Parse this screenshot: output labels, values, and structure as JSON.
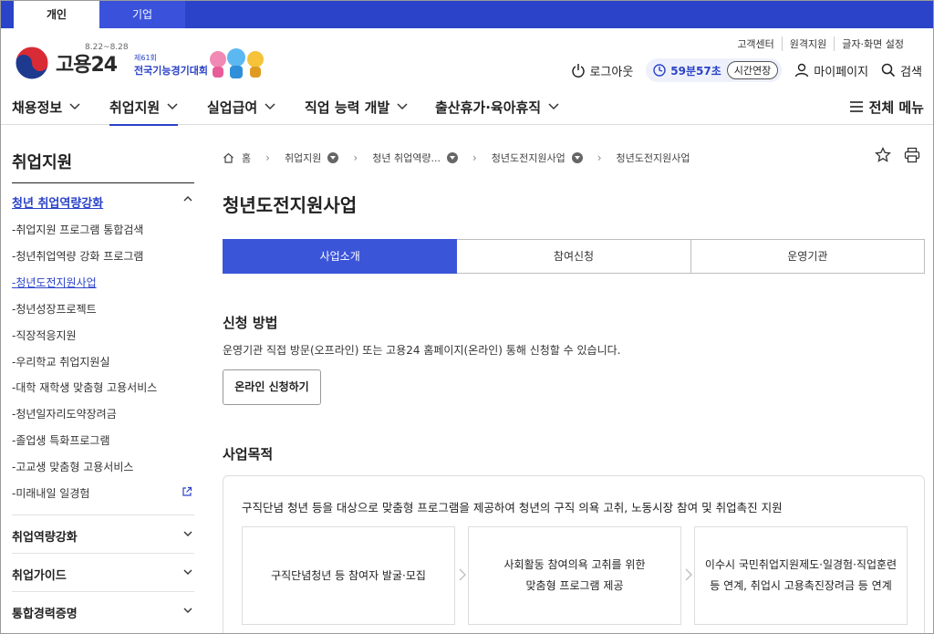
{
  "top_tabs": [
    "개인",
    "기업"
  ],
  "logo": {
    "text": "고용24"
  },
  "event": {
    "dates": "8.22~8.28",
    "sub": "제61회",
    "name": "전국기능경기대회"
  },
  "utility_links": [
    "고객센터",
    "원격지원",
    "글자·화면 설정"
  ],
  "header_actions": {
    "logout": "로그아웃",
    "timer": "59분57초",
    "extend": "시간연장",
    "mypage": "마이페이지",
    "search": "검색"
  },
  "gnb": {
    "items": [
      "채용정보",
      "취업지원",
      "실업급여",
      "직업 능력 개발",
      "출산휴가·육아휴직"
    ],
    "all_menu": "전체 메뉴"
  },
  "sidebar": {
    "title": "취업지원",
    "group": "청년 취업역량강화",
    "subs": [
      "-취업지원 프로그램 통합검색",
      "-청년취업역량 강화 프로그램",
      "-청년도전지원사업",
      "-청년성장프로젝트",
      "-직장적응지원",
      "-우리학교 취업지원실",
      "-대학 재학생 맞춤형 고용서비스",
      "-청년일자리도약장려금",
      "-졸업생 특화프로그램",
      "-고교생 맞춤형 고용서비스",
      "-미래내일 일경험"
    ],
    "categories": [
      "취업역량강화",
      "취업가이드",
      "통합경력증명"
    ]
  },
  "breadcrumb": [
    "홈",
    "취업지원",
    "청년 취업역량...",
    "청년도전지원사업",
    "청년도전지원사업"
  ],
  "page_title": "청년도전지원사업",
  "tabs": [
    "사업소개",
    "참여신청",
    "운영기관"
  ],
  "apply": {
    "title": "신청 방법",
    "desc": "운영기관 직접 방문(오프라인) 또는 고용24 홈페이지(온라인) 통해 신청할 수 있습니다.",
    "button": "온라인 신청하기"
  },
  "purpose": {
    "title": "사업목적",
    "text": "구직단념 청년 등을 대상으로 맞춤형 프로그램을 제공하여 청년의 구직 의욕 고취, 노동시장 참여 및 취업촉진 지원",
    "steps": [
      {
        "line1": "구직단념청년 등 참여자 발굴·모집",
        "line2": ""
      },
      {
        "line1": "사회활동 참여의욕 고취를 위한",
        "line2": "맞춤형 프로그램 제공"
      },
      {
        "line1": "이수시 국민취업지원제도·일경험·직업훈련",
        "line2": "등 연계, 취업시 고용촉진장려금 등 연계"
      }
    ]
  },
  "colors": {
    "primary": "#2b43c8",
    "tab_active": "#3b55d9"
  }
}
